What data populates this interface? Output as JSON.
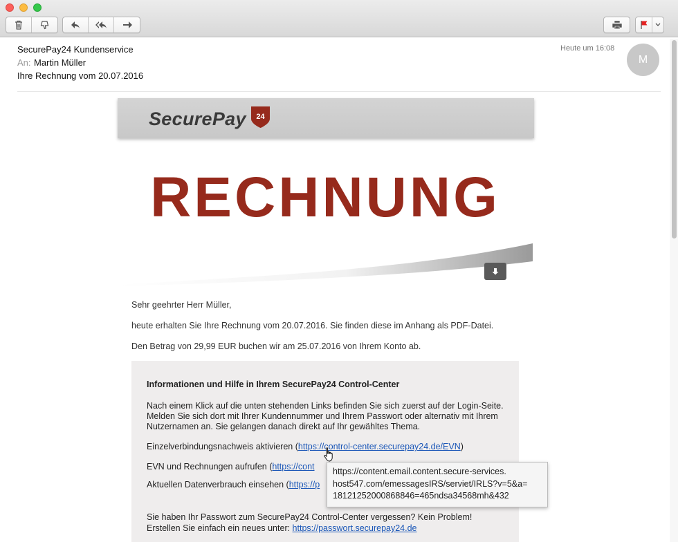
{
  "header": {
    "from": "SecurePay24 Kundenservice",
    "to_label": "An:",
    "to_name": "Martin Müller",
    "subject": "Ihre Rechnung vom 20.07.2016",
    "date": "Heute um 16:08",
    "avatar_initial": "M"
  },
  "colors": {
    "brand_red": "#962a1c",
    "link_blue": "#1a56b7",
    "flag_red": "#e32222"
  },
  "toolbar": {
    "icons": [
      "trash-icon",
      "junk-icon",
      "reply-icon",
      "reply-all-icon",
      "forward-icon",
      "print-icon",
      "flag-icon",
      "chevron-down-icon"
    ]
  },
  "email": {
    "logo_text": "SecurePay",
    "logo_badge": "24",
    "headline": "RECHNUNG",
    "greeting": "Sehr geehrter Herr Müller,",
    "line1": "heute erhalten Sie Ihre Rechnung vom 20.07.2016. Sie finden diese im Anhang als PDF-Datei.",
    "line2": "Den Betrag von 29,99 EUR buchen wir am 25.07.2016 von Ihrem Konto ab.",
    "info": {
      "title": "Informationen und Hilfe in Ihrem SecurePay24 Control-Center",
      "paragraph": "Nach einem Klick auf die unten stehenden Links befinden Sie sich zuerst auf der Login-Seite. Melden Sie sich dort mit Ihrer Kundennummer und Ihrem Passwort oder alternativ mit Ihrem Nutzernamen an. Sie gelangen danach direkt auf Ihr gewähltes Thema.",
      "item1_text": "Einzelverbindungsnachweis aktivieren (",
      "item1_link": "https://control-center.securepay24.de/EVN",
      "item1_close": ")",
      "item2_text": "EVN und Rechnungen aufrufen (",
      "item2_link": "https://cont",
      "item3_text": "Aktuellen Datenverbrauch einsehen (",
      "item3_link": "https://p",
      "pw_line1": "Sie haben Ihr Passwort zum SecurePay24 Control-Center vergessen? Kein Problem!",
      "pw_line2": "Erstellen Sie einfach ein neues unter: ",
      "pw_link": "https://passwort.securepay24.de"
    }
  },
  "tooltip": {
    "line1": "https://content.email.content.secure-services.",
    "line2": "host547.com/emessagesIRS/serviet/IRLS?v=5&a=",
    "line3": "18121252000868846=465ndsa34568mh&432"
  }
}
